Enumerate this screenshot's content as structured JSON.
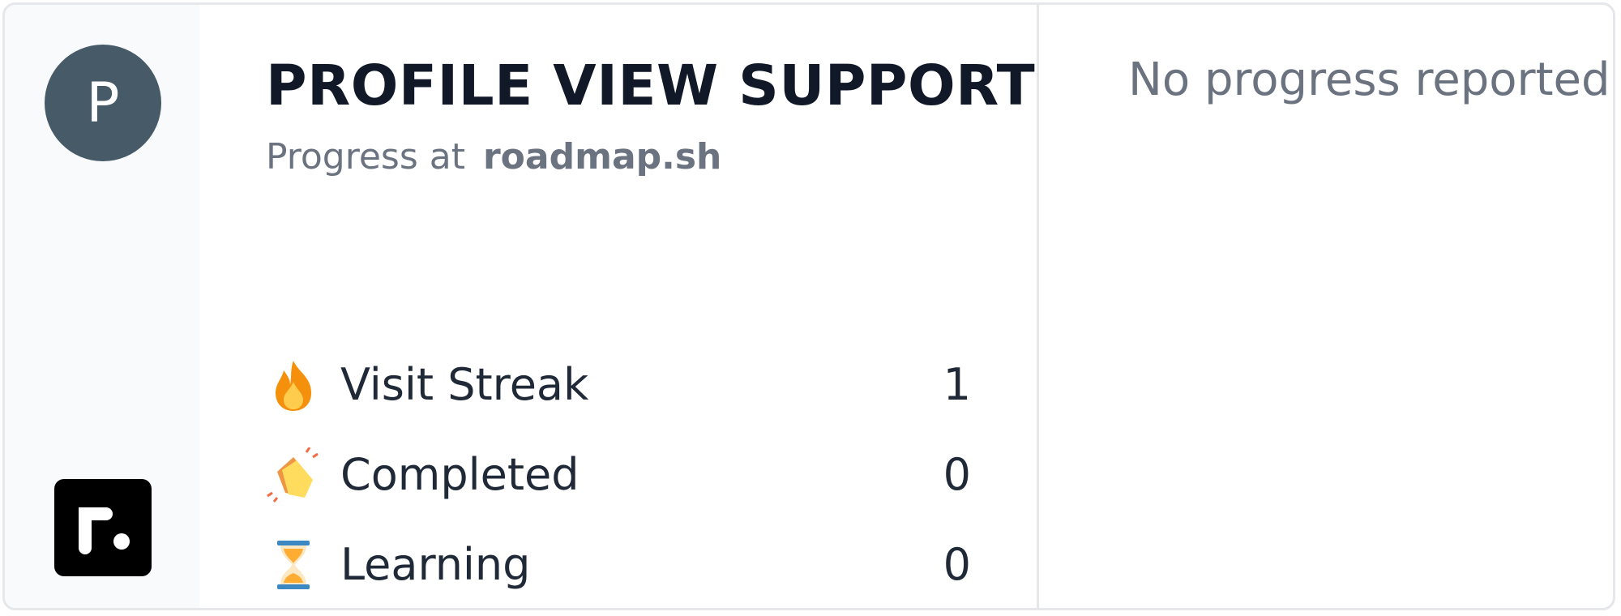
{
  "profile": {
    "avatar_initial": "P",
    "name": "PROFILE VIEW SUPPORT",
    "subtitle_prefix": "Progress at",
    "subtitle_domain": "roadmap.sh"
  },
  "stats": [
    {
      "icon": "fire-icon",
      "label": "Visit Streak",
      "value": "1"
    },
    {
      "icon": "clapping-hands-icon",
      "label": "Completed",
      "value": "0"
    },
    {
      "icon": "hourglass-icon",
      "label": "Learning",
      "value": "0"
    }
  ],
  "progress_panel": {
    "empty_message": "No progress reported yet"
  },
  "colors": {
    "avatar_bg": "#475a67",
    "sidebar_bg": "#f8fafc",
    "border": "#e5e7eb",
    "title": "#111827",
    "muted": "#6b7280"
  }
}
